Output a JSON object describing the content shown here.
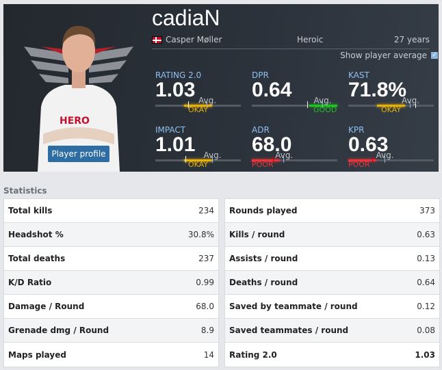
{
  "player": {
    "nickname": "cadiaN",
    "real_name": "Casper Møller",
    "country": "Denmark",
    "team": "Heroic",
    "age": "27 years",
    "profile_button": "Player profile"
  },
  "toggle": {
    "label": "Show player average",
    "checked": true
  },
  "stats": [
    {
      "label": "RATING 2.0",
      "value": "1.03",
      "rating": "OKAY",
      "level": "mid",
      "color": "#e5b00b"
    },
    {
      "label": "DPR",
      "value": "0.64",
      "rating": "GOOD",
      "level": "high",
      "color": "#1fc21f"
    },
    {
      "label": "KAST",
      "value": "71.8%",
      "rating": "OKAY",
      "level": "mid",
      "color": "#e5b00b"
    },
    {
      "label": "IMPACT",
      "value": "1.01",
      "rating": "OKAY",
      "level": "mid",
      "color": "#e5b00b"
    },
    {
      "label": "ADR",
      "value": "68.0",
      "rating": "POOR",
      "level": "low",
      "color": "#e8343a"
    },
    {
      "label": "KPR",
      "value": "0.63",
      "rating": "POOR",
      "level": "low",
      "color": "#e8343a"
    }
  ],
  "avg_label": "Avg.",
  "statistics": {
    "title": "Statistics",
    "left": [
      [
        "Total kills",
        "234"
      ],
      [
        "Headshot %",
        "30.8%"
      ],
      [
        "Total deaths",
        "237"
      ],
      [
        "K/D Ratio",
        "0.99"
      ],
      [
        "Damage / Round",
        "68.0"
      ],
      [
        "Grenade dmg / Round",
        "8.9"
      ],
      [
        "Maps played",
        "14"
      ]
    ],
    "right": [
      [
        "Rounds played",
        "373"
      ],
      [
        "Kills / round",
        "0.63"
      ],
      [
        "Assists / round",
        "0.13"
      ],
      [
        "Deaths / round",
        "0.64"
      ],
      [
        "Saved by teammate / round",
        "0.12"
      ],
      [
        "Saved teammates / round",
        "0.08"
      ],
      [
        "Rating 2.0",
        "1.03"
      ]
    ]
  }
}
